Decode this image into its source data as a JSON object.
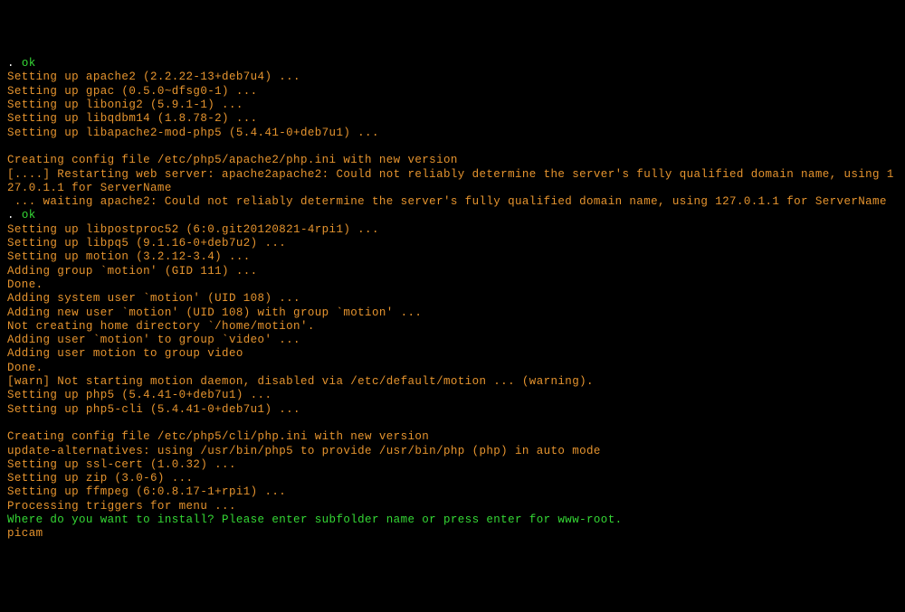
{
  "lines": [
    {
      "parts": [
        {
          "c": "dot",
          "t": ". "
        },
        {
          "c": "green",
          "t": "ok"
        }
      ]
    },
    {
      "parts": [
        {
          "c": "orange",
          "t": "Setting up apache2 (2.2.22-13+deb7u4) ..."
        }
      ]
    },
    {
      "parts": [
        {
          "c": "orange",
          "t": "Setting up gpac (0.5.0~dfsg0-1) ..."
        }
      ]
    },
    {
      "parts": [
        {
          "c": "orange",
          "t": "Setting up libonig2 (5.9.1-1) ..."
        }
      ]
    },
    {
      "parts": [
        {
          "c": "orange",
          "t": "Setting up libqdbm14 (1.8.78-2) ..."
        }
      ]
    },
    {
      "parts": [
        {
          "c": "orange",
          "t": "Setting up libapache2-mod-php5 (5.4.41-0+deb7u1) ..."
        }
      ]
    },
    {
      "parts": [
        {
          "c": "orange",
          "t": ""
        }
      ]
    },
    {
      "parts": [
        {
          "c": "orange",
          "t": "Creating config file /etc/php5/apache2/php.ini with new version"
        }
      ]
    },
    {
      "parts": [
        {
          "c": "orange",
          "t": "[....] Restarting web server: apache2apache2: Could not reliably determine the server's fully qualified domain name, using 127.0.1.1 for ServerName"
        }
      ]
    },
    {
      "parts": [
        {
          "c": "orange",
          "t": " ... waiting apache2: Could not reliably determine the server's fully qualified domain name, using 127.0.1.1 for ServerName"
        }
      ]
    },
    {
      "parts": [
        {
          "c": "dot",
          "t": ". "
        },
        {
          "c": "green",
          "t": "ok"
        }
      ]
    },
    {
      "parts": [
        {
          "c": "orange",
          "t": "Setting up libpostproc52 (6:0.git20120821-4rpi1) ..."
        }
      ]
    },
    {
      "parts": [
        {
          "c": "orange",
          "t": "Setting up libpq5 (9.1.16-0+deb7u2) ..."
        }
      ]
    },
    {
      "parts": [
        {
          "c": "orange",
          "t": "Setting up motion (3.2.12-3.4) ..."
        }
      ]
    },
    {
      "parts": [
        {
          "c": "orange",
          "t": "Adding group `motion' (GID 111) ..."
        }
      ]
    },
    {
      "parts": [
        {
          "c": "orange",
          "t": "Done."
        }
      ]
    },
    {
      "parts": [
        {
          "c": "orange",
          "t": "Adding system user `motion' (UID 108) ..."
        }
      ]
    },
    {
      "parts": [
        {
          "c": "orange",
          "t": "Adding new user `motion' (UID 108) with group `motion' ..."
        }
      ]
    },
    {
      "parts": [
        {
          "c": "orange",
          "t": "Not creating home directory `/home/motion'."
        }
      ]
    },
    {
      "parts": [
        {
          "c": "orange",
          "t": "Adding user `motion' to group `video' ..."
        }
      ]
    },
    {
      "parts": [
        {
          "c": "orange",
          "t": "Adding user motion to group video"
        }
      ]
    },
    {
      "parts": [
        {
          "c": "orange",
          "t": "Done."
        }
      ]
    },
    {
      "parts": [
        {
          "c": "orange",
          "t": "[warn] Not starting motion daemon, disabled via /etc/default/motion ... (warning)."
        }
      ]
    },
    {
      "parts": [
        {
          "c": "orange",
          "t": "Setting up php5 (5.4.41-0+deb7u1) ..."
        }
      ]
    },
    {
      "parts": [
        {
          "c": "orange",
          "t": "Setting up php5-cli (5.4.41-0+deb7u1) ..."
        }
      ]
    },
    {
      "parts": [
        {
          "c": "orange",
          "t": ""
        }
      ]
    },
    {
      "parts": [
        {
          "c": "orange",
          "t": "Creating config file /etc/php5/cli/php.ini with new version"
        }
      ]
    },
    {
      "parts": [
        {
          "c": "orange",
          "t": "update-alternatives: using /usr/bin/php5 to provide /usr/bin/php (php) in auto mode"
        }
      ]
    },
    {
      "parts": [
        {
          "c": "orange",
          "t": "Setting up ssl-cert (1.0.32) ..."
        }
      ]
    },
    {
      "parts": [
        {
          "c": "orange",
          "t": "Setting up zip (3.0-6) ..."
        }
      ]
    },
    {
      "parts": [
        {
          "c": "orange",
          "t": "Setting up ffmpeg (6:0.8.17-1+rpi1) ..."
        }
      ]
    },
    {
      "parts": [
        {
          "c": "orange",
          "t": "Processing triggers for menu ..."
        }
      ]
    },
    {
      "parts": [
        {
          "c": "green",
          "t": "Where do you want to install? Please enter subfolder name or press enter for www-root."
        }
      ]
    },
    {
      "parts": [
        {
          "c": "orange",
          "t": "picam"
        }
      ]
    }
  ]
}
